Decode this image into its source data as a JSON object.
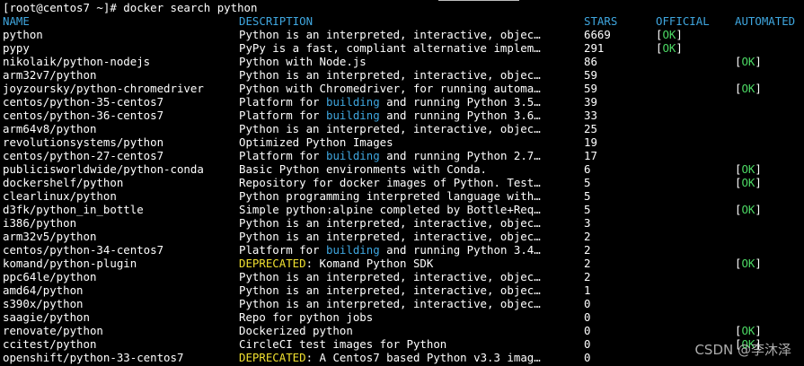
{
  "terminal": {
    "prompt": "[root@centos7 ~]# docker search python",
    "headers": {
      "name": "NAME",
      "description": "DESCRIPTION",
      "stars": "STARS",
      "official": "OFFICIAL",
      "automated": "AUTOMATED"
    },
    "ok_label": "OK",
    "colors": {
      "background": "#000000",
      "text": "#ffffff",
      "header": "#3fa7e0",
      "ok": "#4cd964",
      "highlight_blue": "#3fa7e0",
      "highlight_yellow": "#f0e030"
    },
    "rows": [
      {
        "name": "python",
        "description": "Python is an interpreted, interactive, objec…",
        "stars": "6669",
        "official": true,
        "automated": false
      },
      {
        "name": "pypy",
        "description": "PyPy is a fast, compliant alternative implem…",
        "stars": "291",
        "official": true,
        "automated": false
      },
      {
        "name": "nikolaik/python-nodejs",
        "description": "Python with Node.js",
        "stars": "86",
        "official": false,
        "automated": true
      },
      {
        "name": "arm32v7/python",
        "description": "Python is an interpreted, interactive, objec…",
        "stars": "59",
        "official": false,
        "automated": false
      },
      {
        "name": "joyzoursky/python-chromedriver",
        "description": "Python with Chromedriver, for running automa…",
        "stars": "59",
        "official": false,
        "automated": true
      },
      {
        "name": "centos/python-35-centos7",
        "description": "Platform for building and running Python 3.5…",
        "stars": "39",
        "official": false,
        "automated": false
      },
      {
        "name": "centos/python-36-centos7",
        "description": "Platform for building and running Python 3.6…",
        "stars": "33",
        "official": false,
        "automated": false
      },
      {
        "name": "arm64v8/python",
        "description": "Python is an interpreted, interactive, objec…",
        "stars": "25",
        "official": false,
        "automated": false
      },
      {
        "name": "revolutionsystems/python",
        "description": "Optimized Python Images",
        "stars": "19",
        "official": false,
        "automated": false
      },
      {
        "name": "centos/python-27-centos7",
        "description": "Platform for building and running Python 2.7…",
        "stars": "17",
        "official": false,
        "automated": false
      },
      {
        "name": "publicisworldwide/python-conda",
        "description": "Basic Python environments with Conda.",
        "stars": "6",
        "official": false,
        "automated": true
      },
      {
        "name": "dockershelf/python",
        "description": "Repository for docker images of Python. Test…",
        "stars": "5",
        "official": false,
        "automated": true
      },
      {
        "name": "clearlinux/python",
        "description": "Python programming interpreted language with…",
        "stars": "5",
        "official": false,
        "automated": false
      },
      {
        "name": "d3fk/python_in_bottle",
        "description": "Simple python:alpine completed by Bottle+Req…",
        "stars": "5",
        "official": false,
        "automated": true
      },
      {
        "name": "i386/python",
        "description": "Python is an interpreted, interactive, objec…",
        "stars": "3",
        "official": false,
        "automated": false
      },
      {
        "name": "arm32v5/python",
        "description": "Python is an interpreted, interactive, objec…",
        "stars": "2",
        "official": false,
        "automated": false
      },
      {
        "name": "centos/python-34-centos7",
        "description": "Platform for building and running Python 3.4…",
        "stars": "2",
        "official": false,
        "automated": false
      },
      {
        "name": "komand/python-plugin",
        "description": "DEPRECATED: Komand Python SDK",
        "stars": "2",
        "official": false,
        "automated": true
      },
      {
        "name": "ppc64le/python",
        "description": "Python is an interpreted, interactive, objec…",
        "stars": "2",
        "official": false,
        "automated": false
      },
      {
        "name": "amd64/python",
        "description": "Python is an interpreted, interactive, objec…",
        "stars": "1",
        "official": false,
        "automated": false
      },
      {
        "name": "s390x/python",
        "description": "Python is an interpreted, interactive, objec…",
        "stars": "0",
        "official": false,
        "automated": false
      },
      {
        "name": "saagie/python",
        "description": "Repo for python jobs",
        "stars": "0",
        "official": false,
        "automated": false
      },
      {
        "name": "renovate/python",
        "description": "Dockerized python",
        "stars": "0",
        "official": false,
        "automated": true
      },
      {
        "name": "ccitest/python",
        "description": "CircleCI test images for Python",
        "stars": "0",
        "official": false,
        "automated": true
      },
      {
        "name": "openshift/python-33-centos7",
        "description": "DEPRECATED: A Centos7 based Python v3.3 imag…",
        "stars": "0",
        "official": false,
        "automated": false
      }
    ],
    "highlight_words": {
      "blue": [
        "building"
      ],
      "yellow": [
        "DEPRECATED"
      ]
    }
  },
  "watermark": "CSDN @李沐泽"
}
